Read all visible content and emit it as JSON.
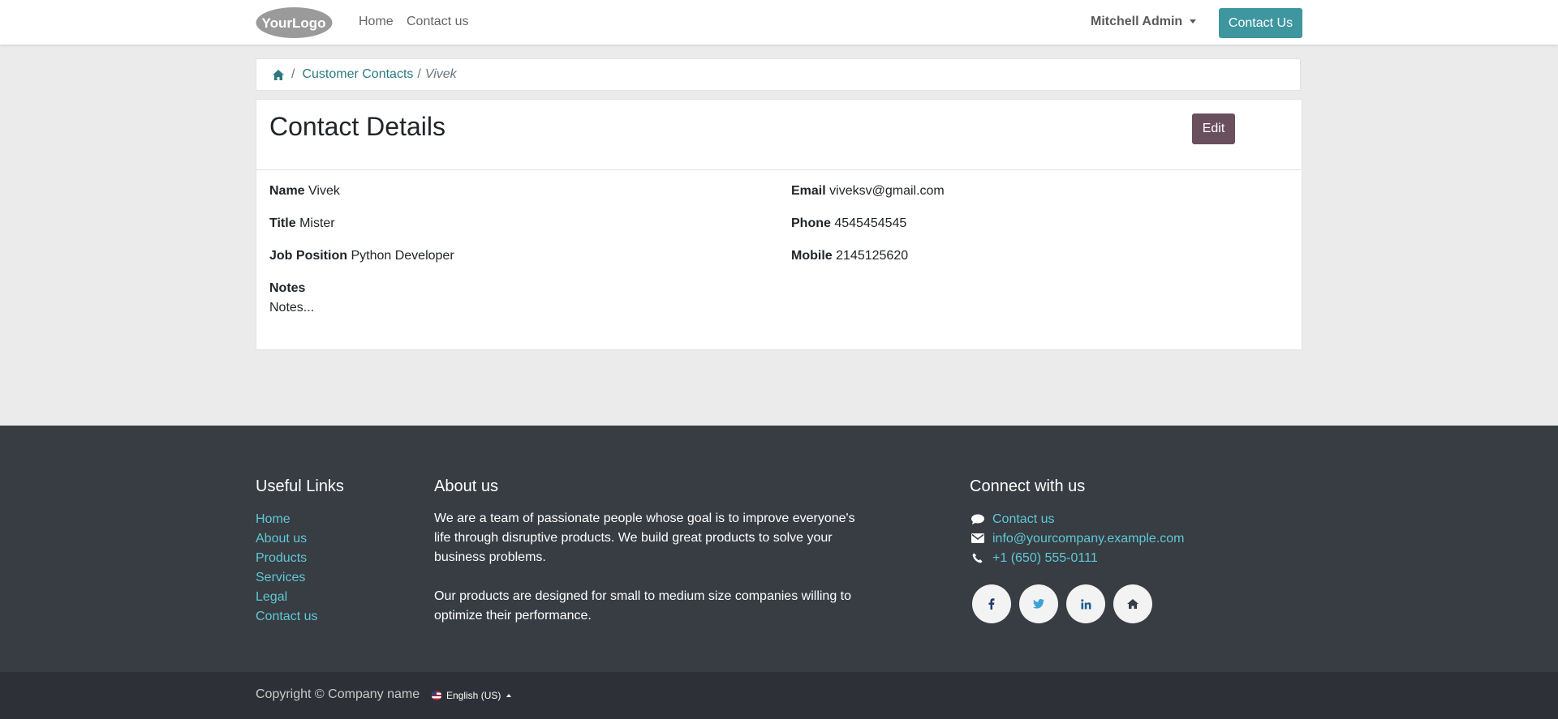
{
  "header": {
    "logo_text": "YourLogo",
    "nav": {
      "home": "Home",
      "contact": "Contact us"
    },
    "user_menu": "Mitchell Admin",
    "contact_button": "Contact Us"
  },
  "breadcrumb": {
    "sep1": "/",
    "parent": "Customer Contacts",
    "sep2": "/",
    "current": "Vivek"
  },
  "contact": {
    "title": "Contact Details",
    "edit_label": "Edit",
    "fields": {
      "name": {
        "label": "Name",
        "value": "Vivek"
      },
      "title": {
        "label": "Title",
        "value": "Mister"
      },
      "job": {
        "label": "Job Position",
        "value": "Python Developer"
      },
      "notes": {
        "label": "Notes",
        "value": "Notes..."
      },
      "email": {
        "label": "Email",
        "value": "viveksv@gmail.com"
      },
      "phone": {
        "label": "Phone",
        "value": "4545454545"
      },
      "mobile": {
        "label": "Mobile",
        "value": "2145125620"
      }
    }
  },
  "footer": {
    "useful_links": {
      "title": "Useful Links",
      "items": [
        "Home",
        "About us",
        "Products",
        "Services",
        "Legal",
        "Contact us"
      ]
    },
    "about": {
      "title": "About us",
      "p1": "We are a team of passionate people whose goal is to improve everyone's life through disruptive products. We build great products to solve your business problems.",
      "p2": "Our products are designed for small to medium size companies willing to optimize their performance."
    },
    "connect": {
      "title": "Connect with us",
      "contact": "Contact us",
      "email": "info@yourcompany.example.com",
      "phone": "+1 (650) 555-0111",
      "social": [
        "facebook-icon",
        "twitter-icon",
        "linkedin-icon",
        "home-icon"
      ]
    },
    "copyright": "Copyright © Company name",
    "language": "English (US)"
  },
  "colors": {
    "accent": "#3e969f",
    "edit_button": "#6a4f5e",
    "footer_bg": "#383c43",
    "footer_link": "#5ec8d4"
  }
}
